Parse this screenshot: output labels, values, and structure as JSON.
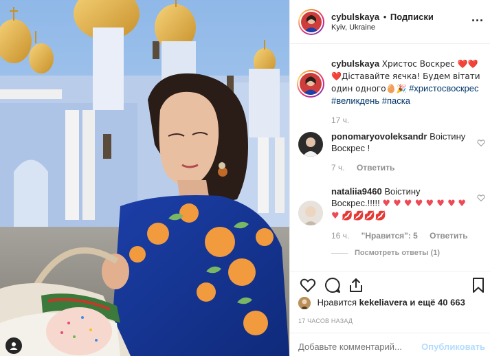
{
  "post": {
    "username": "cybulskaya",
    "dot": "•",
    "follow_label": "Подписки",
    "location": "Kyiv, Ukraine",
    "more_label": "···"
  },
  "caption": {
    "username": "cybulskaya",
    "text_a": "Христос Воскрес ❤️❤️",
    "text_b": "❤️Діставайте яєчка! Будем вітати один одного🥚🎉",
    "hashtags": [
      "#христосвоскрес",
      "#великдень",
      "#паска"
    ],
    "time": "17 ч."
  },
  "comments": [
    {
      "username": "ponomaryovoleksandr",
      "text": "Воістину Воскрес !",
      "time": "7 ч.",
      "reply_label": "Ответить"
    },
    {
      "username": "nataliia9460",
      "text": "Воістину Воскрес.!!!!!",
      "hearts": "♥ ♥ ♥ ♥ ♥ ♥ ♥",
      "hearts2": "♥ ♥",
      "lips": "💋💋💋💋",
      "time": "16 ч.",
      "likes_label": "\"Нравится\": 5",
      "reply_label": "Ответить"
    }
  ],
  "view_replies_label": "Посмотреть ответы (1)",
  "likes": {
    "prefix": "Нравится",
    "user": "kekeliavera",
    "suffix": "и ещё",
    "count": "40 663"
  },
  "time_ago": "17 ЧАСОВ НАЗАД",
  "add_comment": {
    "placeholder": "Добавьте комментарий...",
    "post_label": "Опубликовать"
  }
}
